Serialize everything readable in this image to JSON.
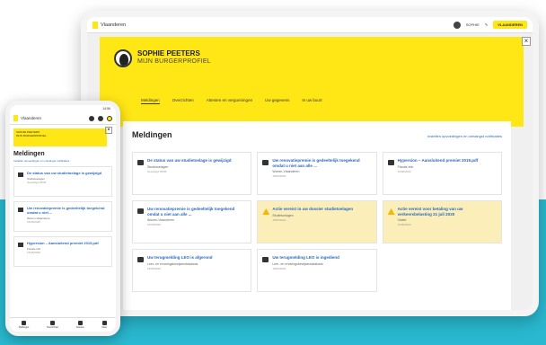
{
  "app": {
    "brand": "Vlaanderen",
    "top_user": "SOPHIE",
    "top_button": "VLAANDEREN"
  },
  "hero": {
    "name": "SOPHIE PEETERS",
    "subtitle": "MIJN BURGERPROFIEL",
    "tabs": [
      "Meldingen",
      "Overzichten",
      "Attesten en vergunningen",
      "Uw gegevens",
      "In uw buurt"
    ]
  },
  "page": {
    "title": "Meldingen",
    "settings_link": "Instellen opvoedingen en ontvangst notificaties"
  },
  "cards": [
    {
      "title": "De status van uw studietoelage is gewijzigd",
      "meta": "Studietoelagen",
      "date": "Gewijzigd 25/06",
      "warn": false
    },
    {
      "title": "Uw renovatiepremie is gedeeltelijk toegekend omdat u niet aan alle ...",
      "meta": "Wonen-Vlaanderen",
      "date": "15/06/2020",
      "warn": false
    },
    {
      "title": "Hypersion – Aansluitend premiet 2019.pdf",
      "meta": "Fiscale info",
      "date": "15/06/2020",
      "warn": false
    },
    {
      "title": "Uw renovatiepremie is gedeeltelijk toegekend omdat u niet aan alle ...",
      "meta": "Wonen-Vlaanderen",
      "date": "15/06/2020",
      "warn": false
    },
    {
      "title": "Actie vereist in uw dossier studietoelagen",
      "meta": "Studietoelagen",
      "date": "15/06/2020",
      "warn": true
    },
    {
      "title": "Actie vereist voor betaling van uw verkeersbelasting 21 juli 2020",
      "meta": "Vlabel",
      "date": "15/06/2020",
      "warn": true
    },
    {
      "title": "Uw terugmelding LEO is afgerond",
      "meta": "Leer- en ervaringsbewijsendatabank",
      "date": "15/06/2020",
      "warn": false
    },
    {
      "title": "Uw terugmelding LEO is ingediend",
      "meta": "Leer- en ervaringsbewijsendatabank",
      "date": "15/06/2020",
      "warn": false
    }
  ],
  "phone": {
    "time": "14:56",
    "hero_line1": "SOPHIE PEETERS",
    "hero_line2": "MIJN BURGERPROFIEL",
    "cards": [
      {
        "title": "De status van uw studietoelage is gewijzigd",
        "meta": "Studietoelagen",
        "date": "Gewijzigd 25/06"
      },
      {
        "title": "Uw renovatiepremie is gedeeltelijk toegekend omdat u niet ...",
        "meta": "Wonen-Vlaanderen",
        "date": "15/06/2020"
      },
      {
        "title": "Hypersion – Aansluitend premiet 2019.pdf",
        "meta": "Fiscale info",
        "date": "15/06/2020"
      }
    ],
    "nav": [
      "Meldingen",
      "Overzichten",
      "Attesten",
      "Meer"
    ]
  }
}
